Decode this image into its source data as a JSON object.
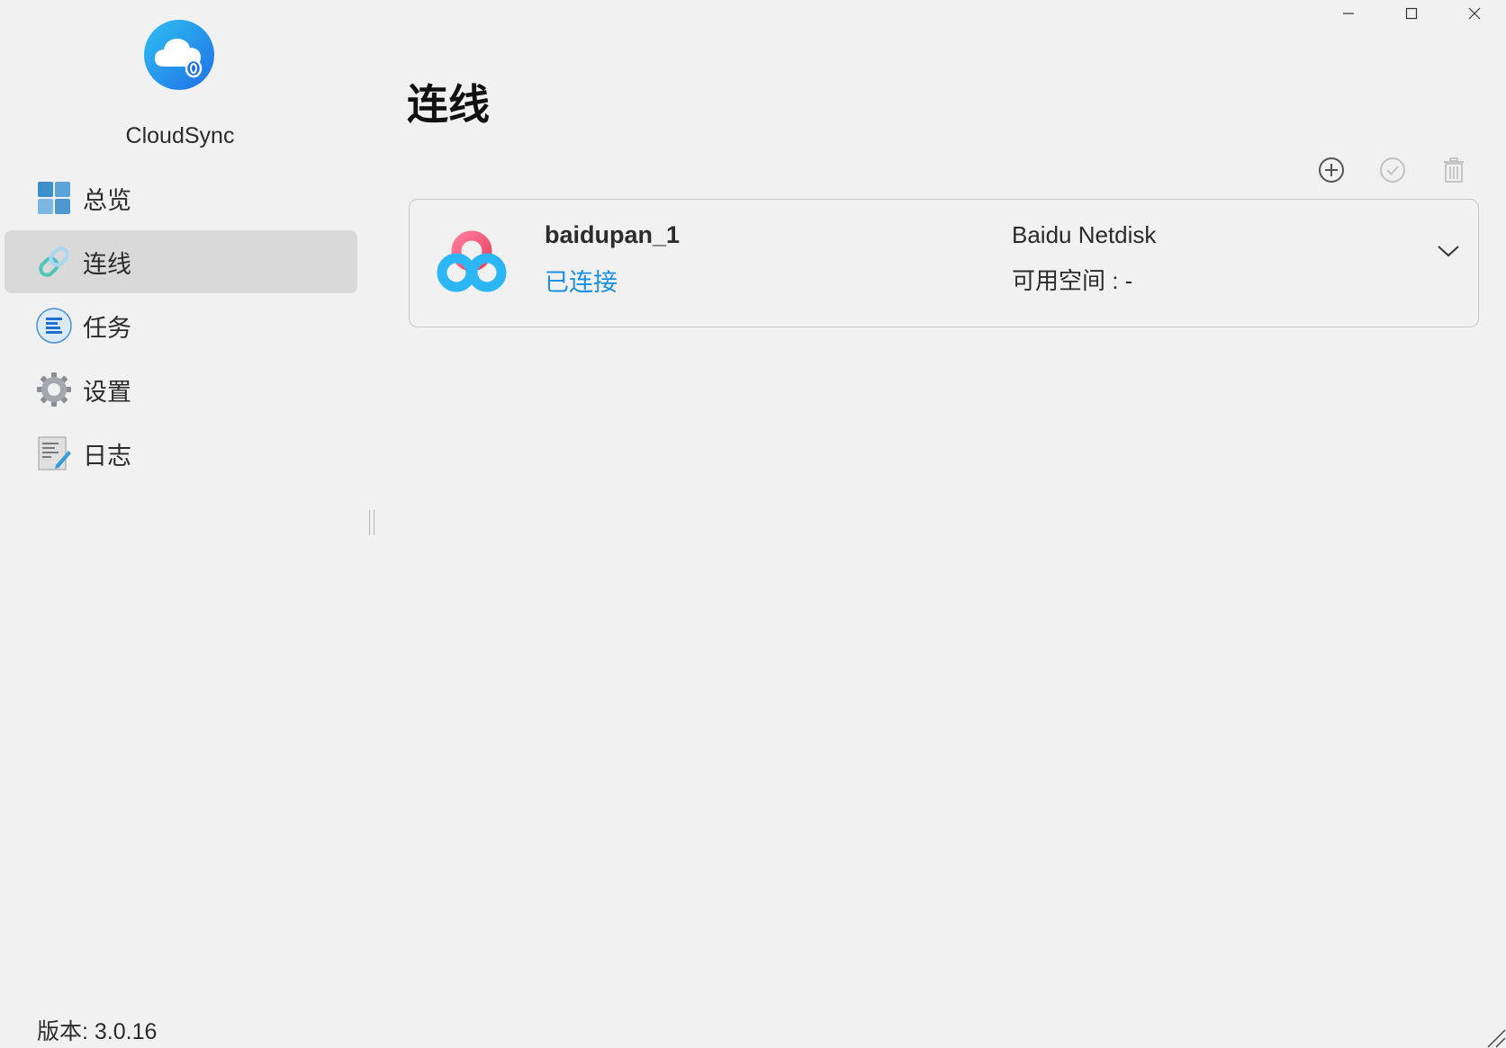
{
  "app": {
    "name": "CloudSync",
    "version_label": "版本: 3.0.16"
  },
  "window": {
    "minimize_icon": "minimize-icon",
    "maximize_icon": "maximize-icon",
    "close_icon": "close-icon"
  },
  "sidebar": {
    "items": [
      {
        "label": "总览",
        "icon": "overview-grid-icon",
        "active": false
      },
      {
        "label": "连线",
        "icon": "link-icon",
        "active": true
      },
      {
        "label": "任务",
        "icon": "task-list-icon",
        "active": false
      },
      {
        "label": "设置",
        "icon": "gear-icon",
        "active": false
      },
      {
        "label": "日志",
        "icon": "log-document-icon",
        "active": false
      }
    ]
  },
  "main": {
    "title": "连线",
    "toolbar": {
      "add_icon": "add-circle-icon",
      "check_icon": "check-circle-icon",
      "delete_icon": "trash-icon"
    },
    "connections": [
      {
        "name": "baidupan_1",
        "status": "已连接",
        "provider": "Baidu Netdisk",
        "space_label": "可用空间 : -",
        "logo_icon": "baidu-netdisk-logo-icon"
      }
    ]
  },
  "colors": {
    "background": "#f1f1f1",
    "active_nav": "#d9d9d9",
    "status_connected": "#1a8fe0",
    "card_border": "#c6c6c6"
  }
}
